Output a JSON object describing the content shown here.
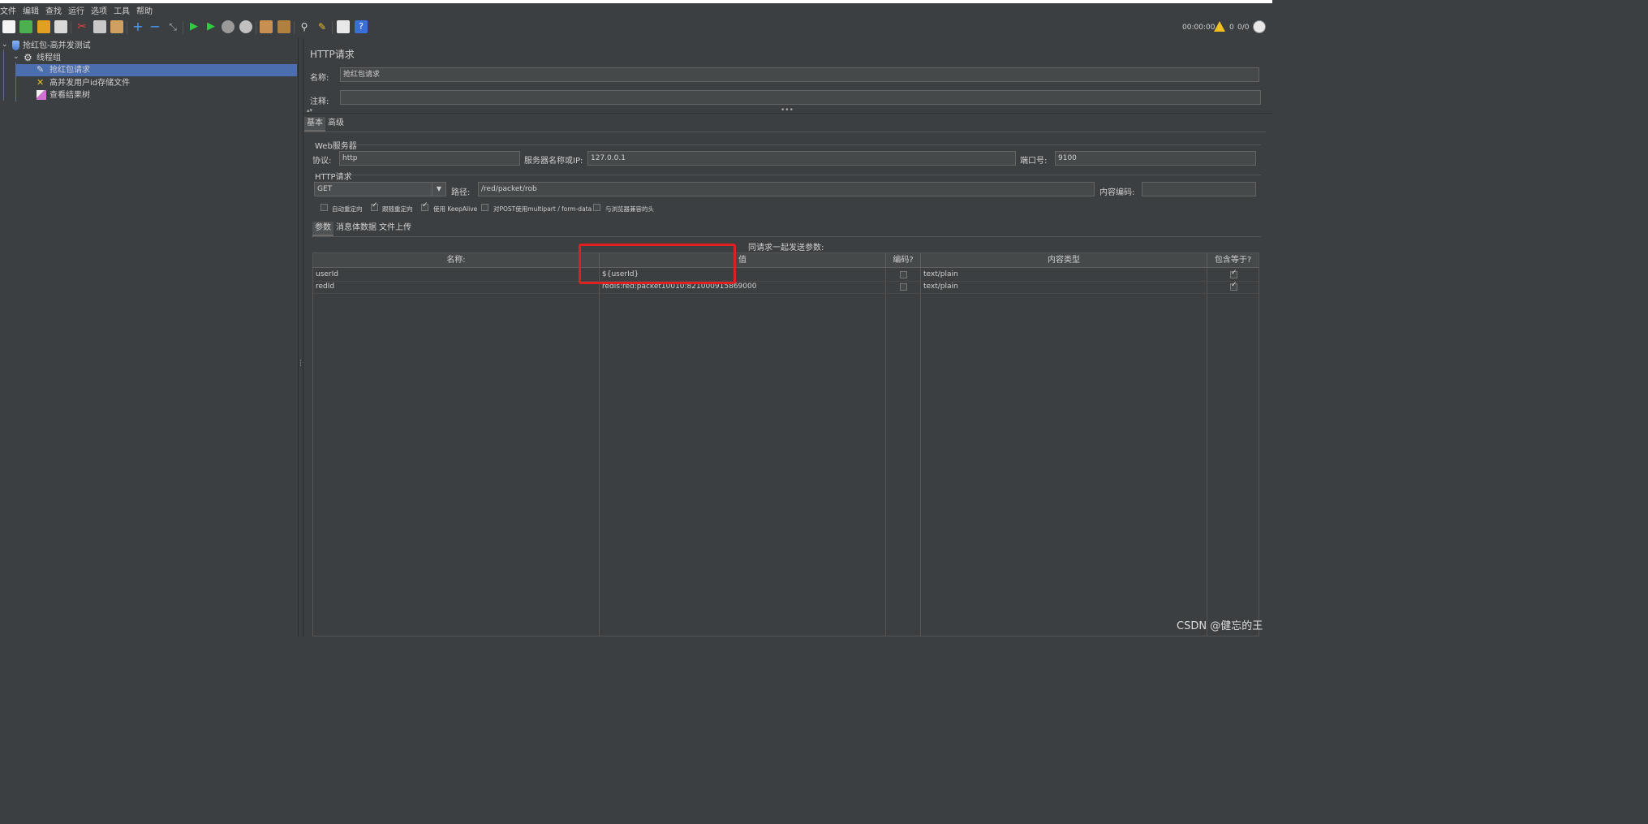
{
  "menu": [
    "文件",
    "编辑",
    "查找",
    "运行",
    "选项",
    "工具",
    "帮助"
  ],
  "toolbar_icons": [
    "new-icon",
    "templates-icon",
    "open-icon",
    "save-icon",
    "cut-icon",
    "copy-icon",
    "paste-icon",
    "expand-icon",
    "collapse-icon",
    "toggle-icon",
    "start-icon",
    "start-no-pause-icon",
    "stop-icon",
    "shutdown-icon",
    "clear-icon",
    "clear-all-icon",
    "search-icon",
    "reset-search-icon",
    "function-helper-icon",
    "help-icon"
  ],
  "status": {
    "timer": "00:00:00",
    "warnings": "0",
    "threads": "0/0"
  },
  "tree": {
    "root": "抢红包-高并发测试",
    "thread_group": "线程组",
    "items": [
      {
        "label": "抢红包请求",
        "selected": true
      },
      {
        "label": "高并发用户id存储文件",
        "selected": false
      },
      {
        "label": "查看结果树",
        "selected": false
      }
    ]
  },
  "panel": {
    "title": "HTTP请求",
    "name_label": "名称:",
    "name_value": "抢红包请求",
    "comment_label": "注释:",
    "comment_value": "",
    "tabs": [
      "基本",
      "高级"
    ],
    "web_server_title": "Web服务器",
    "protocol_label": "协议:",
    "protocol_value": "http",
    "server_label": "服务器名称或IP:",
    "server_value": "127.0.0.1",
    "port_label": "端口号:",
    "port_value": "9100",
    "http_request_title": "HTTP请求",
    "method_value": "GET",
    "path_label": "路径:",
    "path_value": "/red/packet/rob",
    "encoding_label": "内容编码:",
    "encoding_value": "",
    "options": [
      {
        "label": "自动重定向",
        "checked": false
      },
      {
        "label": "跟随重定向",
        "checked": true
      },
      {
        "label": "使用 KeepAlive",
        "checked": true
      },
      {
        "label": "对POST使用multipart / form-data",
        "checked": false
      },
      {
        "label": "与浏览器兼容的头",
        "checked": false
      }
    ],
    "sub_tabs": [
      "参数",
      "消息体数据",
      "文件上传"
    ],
    "params_caption": "同请求一起发送参数:",
    "table": {
      "headers": [
        "名称:",
        "值",
        "编码?",
        "内容类型",
        "包含等于?"
      ],
      "rows": [
        {
          "name": "userId",
          "value": "${userId}",
          "encode": false,
          "content_type": "text/plain",
          "include_equals": true
        },
        {
          "name": "redId",
          "value": "redis:red:packet10010:821000915869000",
          "encode": false,
          "content_type": "text/plain",
          "include_equals": true
        }
      ]
    }
  },
  "watermark": "CSDN @健忘的王",
  "colors": {
    "background": "#3c3f41",
    "selection": "#4b6eaf",
    "highlight_box": "#e02020"
  }
}
